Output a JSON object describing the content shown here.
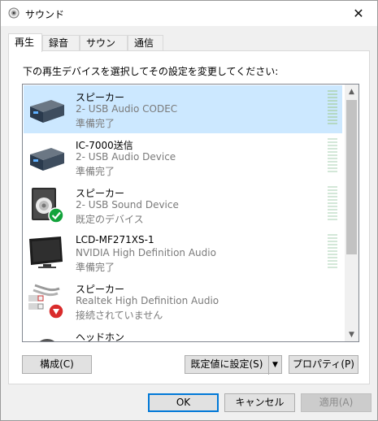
{
  "window": {
    "title": "サウンド",
    "close": "✕"
  },
  "tabs": [
    {
      "label": "再生",
      "active": true
    },
    {
      "label": "録音",
      "active": false
    },
    {
      "label": "サウンド",
      "active": false
    },
    {
      "label": "通信",
      "active": false
    }
  ],
  "instruction": "下の再生デバイスを選択してその設定を変更してください:",
  "devices": [
    {
      "name": "スピーカー",
      "sub": "2- USB Audio CODEC",
      "status": "準備完了",
      "icon": "usb-audio-box-icon",
      "selected": true
    },
    {
      "name": "IC-7000送信",
      "sub": "2- USB Audio Device",
      "status": "準備完了",
      "icon": "usb-audio-box-icon",
      "selected": false
    },
    {
      "name": "スピーカー",
      "sub": "2- USB Sound Device",
      "status": "既定のデバイス",
      "icon": "speaker-default-icon",
      "selected": false
    },
    {
      "name": "LCD-MF271XS-1",
      "sub": "NVIDIA High Definition Audio",
      "status": "準備完了",
      "icon": "monitor-icon",
      "selected": false
    },
    {
      "name": "スピーカー",
      "sub": "Realtek High Definition Audio",
      "status": "接続されていません",
      "icon": "rca-cable-disconnected-icon",
      "selected": false
    },
    {
      "name": "ヘッドホン",
      "sub": "",
      "status": "",
      "icon": "headphones-icon",
      "selected": false
    }
  ],
  "buttons": {
    "configure": "構成(C)",
    "set_default": "既定値に設定(S)",
    "properties": "プロパティ(P)",
    "ok": "OK",
    "cancel": "キャンセル",
    "apply": "適用(A)"
  },
  "colors": {
    "selection": "#cce8ff",
    "accent": "#0078d7",
    "check": "#12a33b",
    "disconnect": "#d92b2b"
  }
}
